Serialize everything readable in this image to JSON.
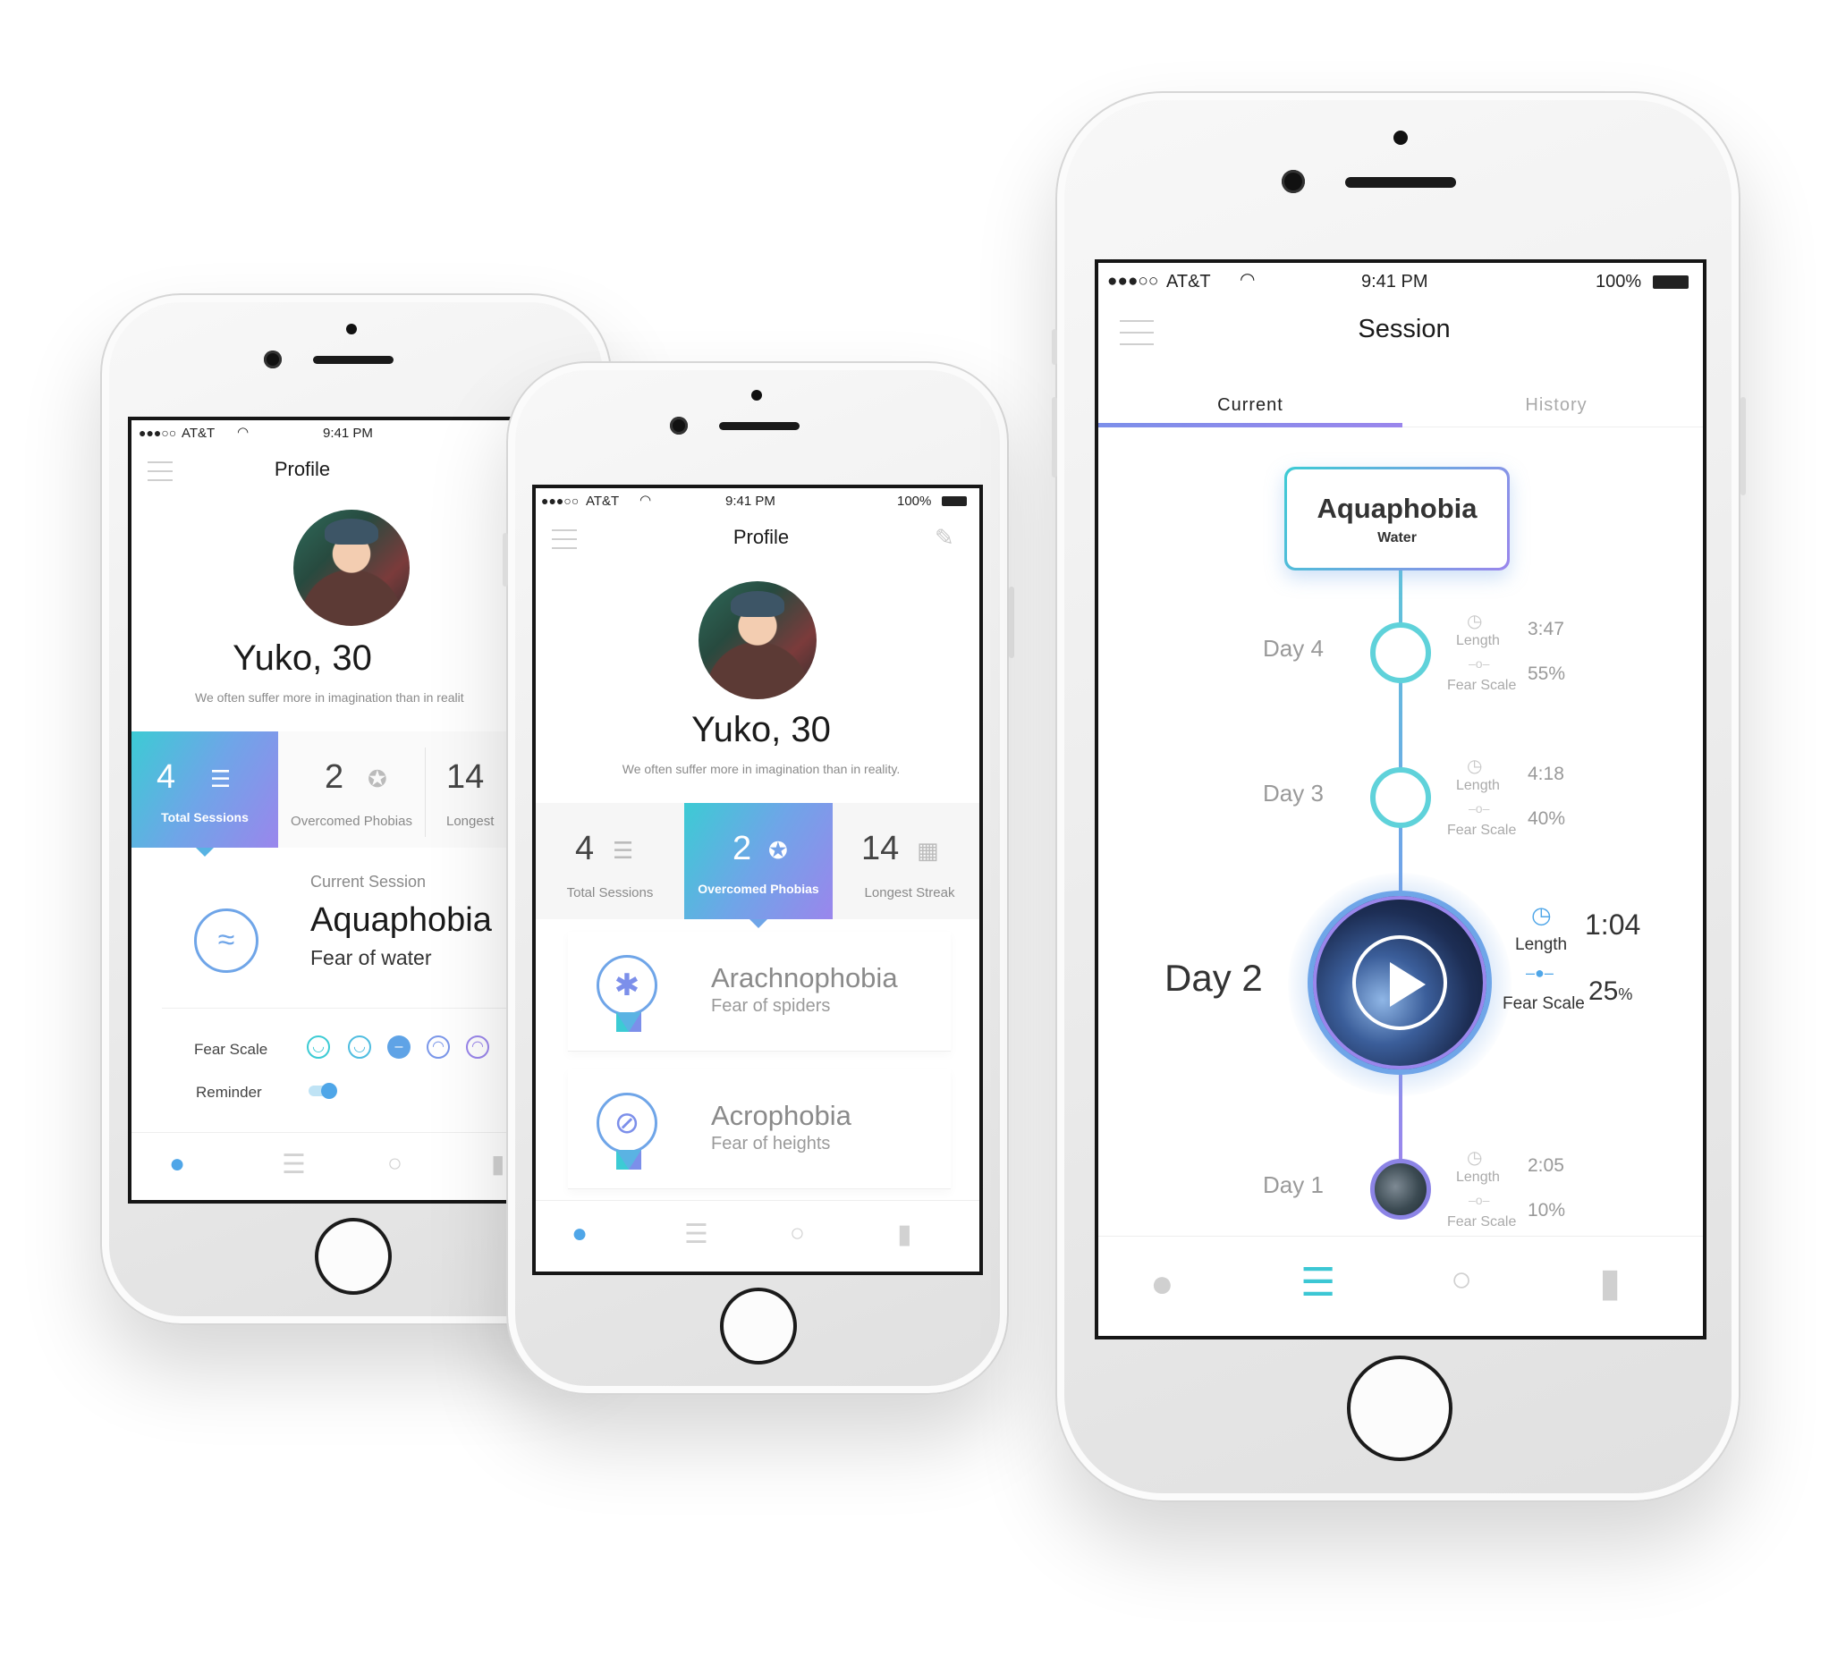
{
  "status": {
    "carrier": "AT&T",
    "signal": "●●●○○",
    "time": "9:41 PM",
    "battery": "100%",
    "battery_left_truncated": "10"
  },
  "profile": {
    "title": "Profile",
    "name": "Yuko, 30",
    "quote": "We often suffer more in imagination than in reality.",
    "quote_truncated": "We often suffer more in imagination than in realit",
    "stats": [
      {
        "value": "4",
        "label": "Total Sessions"
      },
      {
        "value": "2",
        "label": "Overcomed Phobias"
      },
      {
        "value": "14",
        "label": "Longest Streak",
        "label_truncated": "Longest"
      }
    ],
    "current_session": {
      "heading": "Current Session",
      "phobia": "Aquaphobia",
      "description": "Fear of water"
    },
    "fear_scale_label": "Fear Scale",
    "reminder_label": "Reminder",
    "reminder_on": true,
    "fear_scale_selected_index": 2,
    "overcome": [
      {
        "name": "Arachnophobia",
        "description": "Fear of spiders",
        "icon": "spider-badge-icon"
      },
      {
        "name": "Acrophobia",
        "description": "Fear of heights",
        "icon": "ladder-badge-icon"
      }
    ]
  },
  "session": {
    "title": "Session",
    "tabs": [
      "Current",
      "History"
    ],
    "active_tab": "Current",
    "phobia": "Aquaphobia",
    "phobia_sub": "Water",
    "length_label": "Length",
    "fear_label": "Fear Scale",
    "days": [
      {
        "label": "Day 4",
        "length": "3:47",
        "fear": "55%"
      },
      {
        "label": "Day 3",
        "length": "4:18",
        "fear": "40%"
      },
      {
        "label": "Day 2",
        "length": "1:04",
        "fear_value": "25",
        "fear_unit": "%"
      },
      {
        "label": "Day 1",
        "length": "2:05",
        "fear": "10%"
      }
    ]
  },
  "tabbar": [
    "profile-icon",
    "sessions-list-icon",
    "search-icon",
    "library-book-icon"
  ],
  "colors": {
    "teal": "#3ccbd4",
    "blue": "#6fa5e8",
    "purple": "#9a86ec",
    "gray": "#8a8a8a"
  }
}
